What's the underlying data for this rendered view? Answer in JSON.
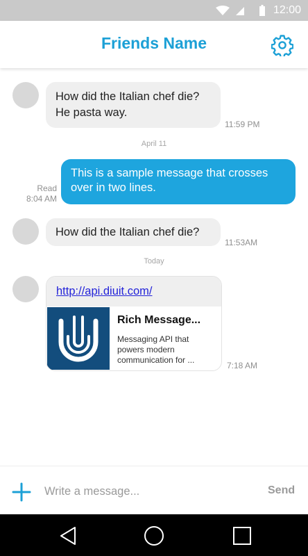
{
  "status_bar": {
    "time": "12:00",
    "wifi_icon": "wifi-icon",
    "signal_icon": "signal-icon",
    "battery_icon": "battery-icon"
  },
  "header": {
    "title": "Friends Name",
    "settings_icon": "gear-icon"
  },
  "messages": [
    {
      "direction": "incoming",
      "text": "How did the Italian chef die?\nHe pasta way.",
      "time": "11:59 PM"
    },
    {
      "type": "date-separator",
      "text": "April 11"
    },
    {
      "direction": "outgoing",
      "text": "This is a sample message that crosses over in two lines.",
      "status": "Read",
      "time": "8:04 AM"
    },
    {
      "direction": "incoming",
      "text": "How did the Italian chef die?",
      "time": "11:53AM"
    },
    {
      "type": "date-separator",
      "text": "Today"
    },
    {
      "direction": "incoming",
      "type": "rich",
      "link": "http://api.diuit.com/",
      "title": "Rich Message...",
      "description": "Messaging API that powers modern communication for ...",
      "time": "7:18 AM"
    }
  ],
  "composer": {
    "placeholder": "Write a message...",
    "send_label": "Send",
    "add_icon": "plus-icon"
  },
  "nav_bar": {
    "icons": [
      "back-icon",
      "home-icon",
      "recents-icon"
    ]
  },
  "colors": {
    "accent": "#1ca0d6",
    "outgoing_bubble": "#1ea5de",
    "incoming_bubble": "#efefef",
    "status_bar": "#c9c9c9",
    "card_thumb": "#134d7d"
  }
}
